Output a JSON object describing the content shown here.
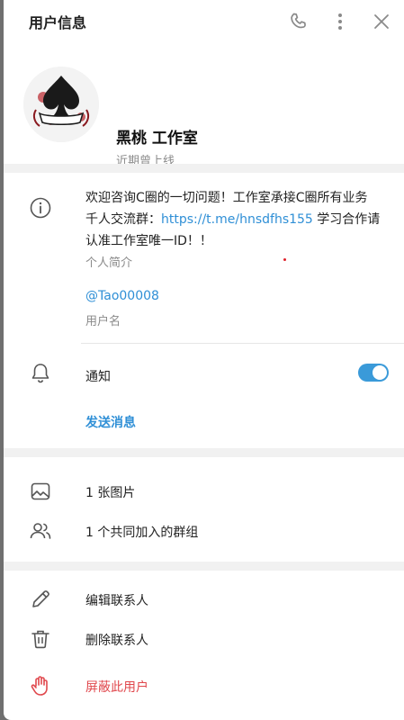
{
  "header": {
    "title": "用户信息"
  },
  "profile": {
    "name": "黑桃 工作室",
    "status": "近期曾上线"
  },
  "info": {
    "bio_part1": "欢迎咨询C圈的一切问题！工作室承接C圈所有业务 千人交流群：",
    "bio_link": "https://t.me/hnsdfhs155",
    "bio_part2": " 学习合作请认准工作室唯一ID！！",
    "bio_label": "个人简介",
    "username": "@Tao00008",
    "username_label": "用户名"
  },
  "notifications": {
    "label": "通知",
    "enabled": true
  },
  "send_message": "发送消息",
  "media": {
    "photos": "1 张图片",
    "groups": "1 个共同加入的群组"
  },
  "actions": {
    "edit": "编辑联系人",
    "delete": "删除联系人",
    "block": "屏蔽此用户"
  },
  "colors": {
    "accent": "#2f8fd6",
    "danger": "#e0474c",
    "toggle": "#3a9ad9"
  }
}
